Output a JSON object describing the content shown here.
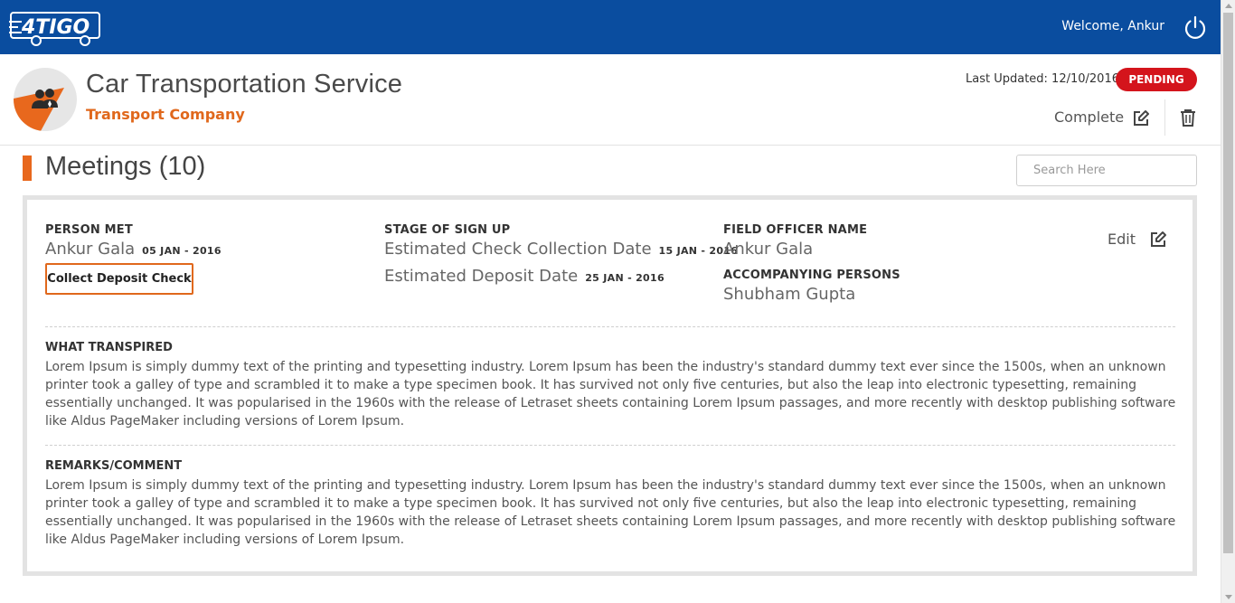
{
  "topbar": {
    "logo_text": "4TIGO",
    "welcome": "Welcome, Ankur",
    "power_icon": "power-icon"
  },
  "header": {
    "company_name": "Car Transportation Service",
    "company_type": "Transport Company",
    "last_updated": "Last Updated: 12/10/2016",
    "status": "PENDING",
    "complete_label": "Complete",
    "icons": [
      "users-icon",
      "edit-icon",
      "trash-icon"
    ]
  },
  "section": {
    "title": "Meetings (10)",
    "search_placeholder": "Search Here"
  },
  "meeting": {
    "person_met_label": "PERSON MET",
    "person_met": "Ankur Gala",
    "person_met_date": "05 JAN - 2016",
    "action_button": "Collect Deposit Check",
    "stage_label": "STAGE OF SIGN UP",
    "check_collection_label": "Estimated Check Collection Date",
    "check_collection_date": "15 JAN - 2016",
    "deposit_label": "Estimated Deposit Date",
    "deposit_date": "25 JAN - 2016",
    "field_officer_label": "FIELD OFFICER NAME",
    "field_officer": "Ankur Gala",
    "accompanying_label": "ACCOMPANYING PERSONS",
    "accompanying": "Shubham Gupta",
    "edit_label": "Edit",
    "transpired_label": "WHAT TRANSPIRED",
    "transpired_text": "Lorem Ipsum is simply dummy text of the printing and typesetting industry. Lorem Ipsum has been the industry's standard dummy text ever since the 1500s, when an unknown printer took a galley of type and scrambled it to make a type specimen book. It has survived not only five centuries, but also the leap into electronic typesetting, remaining essentially unchanged. It was popularised in the 1960s with the release of Letraset sheets containing Lorem Ipsum passages, and more recently with desktop publishing software like Aldus PageMaker including versions of Lorem Ipsum.",
    "remarks_label": "REMARKS/COMMENT",
    "remarks_text": "Lorem Ipsum is simply dummy text of the printing and typesetting industry. Lorem Ipsum has been the industry's standard dummy text ever since the 1500s, when an unknown printer took a galley of type and scrambled it to make a type specimen book. It has survived not only five centuries, but also the leap into electronic typesetting, remaining essentially unchanged. It was popularised in the 1960s with the release of Letraset sheets containing Lorem Ipsum passages, and more recently with desktop publishing software like Aldus PageMaker including versions of Lorem Ipsum."
  },
  "colors": {
    "topbar": "#0a4d9f",
    "accent_orange": "#e0681c",
    "status_red": "#d4141c"
  }
}
